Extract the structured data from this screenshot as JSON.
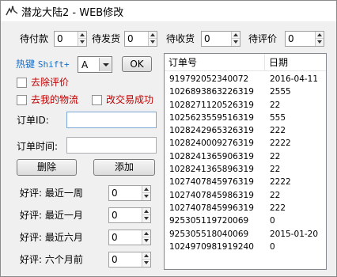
{
  "window": {
    "title": "潜龙大陆2 - WEB修改",
    "icon": "dragon-logo-icon"
  },
  "status_counts": [
    {
      "label": "待付款",
      "value": "0"
    },
    {
      "label": "待发货",
      "value": "0"
    },
    {
      "label": "待收货",
      "value": "0"
    },
    {
      "label": "待评价",
      "value": "0"
    }
  ],
  "hotkey": {
    "label": "热键",
    "modifier": "Shift+",
    "selected_key": "A",
    "ok_label": "OK"
  },
  "checkboxes": {
    "remove_review": {
      "label": "去除评价",
      "checked": false
    },
    "my_logistics": {
      "label": "去我的物流",
      "checked": false
    },
    "change_success": {
      "label": "改交易成功",
      "checked": false
    }
  },
  "order_id": {
    "label": "订单ID:",
    "value": ""
  },
  "order_time": {
    "label": "订单时间:",
    "value": ""
  },
  "buttons": {
    "delete": "删除",
    "add": "添加"
  },
  "reviews": [
    {
      "label": "好评: 最近一周",
      "value": "0"
    },
    {
      "label": "好评: 最近一月",
      "value": "0"
    },
    {
      "label": "好评: 最近六月",
      "value": "0"
    },
    {
      "label": "好评: 六个月前",
      "value": "0"
    }
  ],
  "order_table": {
    "columns": [
      "订单号",
      "日期"
    ],
    "rows": [
      [
        "919792052340072",
        "2016-04-11"
      ],
      [
        "1026893863226319",
        "2555"
      ],
      [
        "1028271120526319",
        "22"
      ],
      [
        "1025623559516319",
        "555"
      ],
      [
        "1028242965326319",
        "222"
      ],
      [
        "1028240009276319",
        "2222"
      ],
      [
        "1028241365906319",
        "22"
      ],
      [
        "1028241365896319",
        "22"
      ],
      [
        "1027407845976319",
        "2222"
      ],
      [
        "1027407845986319",
        "22"
      ],
      [
        "1027407845996319",
        "222"
      ],
      [
        "925305119720069",
        "0"
      ],
      [
        "925305518040069",
        "2015-01-20"
      ],
      [
        "1024970981919240",
        "0"
      ]
    ]
  },
  "colors": {
    "hotkey_blue": "#1a6fc6",
    "checkbox_label_red": "#c00000",
    "window_bg": "#f0f0f0"
  }
}
